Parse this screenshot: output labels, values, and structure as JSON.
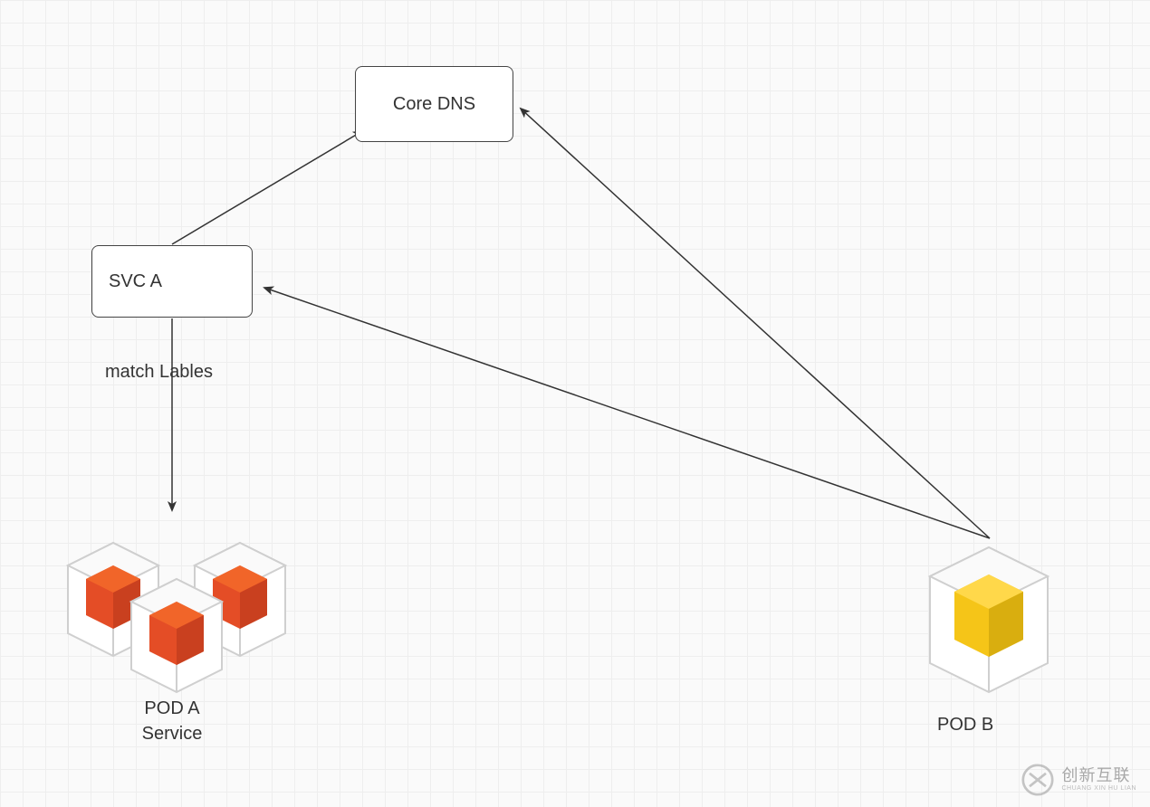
{
  "nodes": {
    "core_dns": {
      "label": "Core DNS"
    },
    "svc_a": {
      "label": "SVC A"
    }
  },
  "edges": {
    "match_labels": "match Lables"
  },
  "pods": {
    "pod_a": {
      "label_line1": "POD A",
      "label_line2": "Service",
      "color": "#E34C26"
    },
    "pod_b": {
      "label": "POD B",
      "color": "#F5C518"
    }
  },
  "watermark": {
    "cn": "创新互联",
    "en": "CHUANG XIN HU LIAN"
  },
  "colors": {
    "cube_outline": "#CFCFCF",
    "cube_face": "#FFFFFF",
    "orange": "#E44D26",
    "orange_dark": "#C9401F",
    "yellow": "#F5C518",
    "yellow_dark": "#D9AE0F"
  }
}
